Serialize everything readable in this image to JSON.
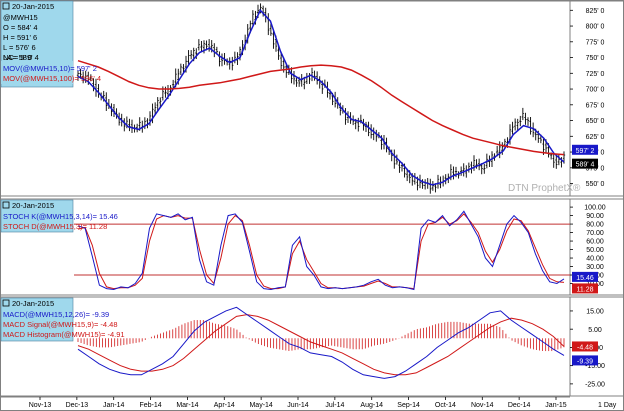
{
  "chart_data": [
    {
      "type": "ohlc",
      "panel": "price",
      "header": "20-Jan-2015",
      "info_lines": [
        "@MWH15",
        "O = 584' 4",
        "H = 591' 6",
        "L = 576' 6",
        "LA= 589' 4",
        "NC= 5' 0"
      ],
      "indicator_labels": [
        "MOV(@MWH15,10)= 597' 2",
        "MOV(@MWH15,100)= 596' 4"
      ],
      "y_ticks": [
        "825' 0",
        "800' 0",
        "775' 0",
        "750' 0",
        "725' 0",
        "700' 0",
        "675' 0",
        "650' 0",
        "625' 0",
        "600' 0",
        "575' 0",
        "550' 0"
      ],
      "ylim": [
        535,
        835
      ],
      "last_tags": [
        "597' 2",
        "589' 4"
      ],
      "watermark": "DTN ProphetX®",
      "series": [
        {
          "name": "MOV(@MWH15,10)",
          "color": "#1818c8",
          "values": [
            720,
            712,
            695,
            675,
            655,
            640,
            636,
            645,
            668,
            690,
            715,
            740,
            758,
            765,
            752,
            742,
            750,
            790,
            825,
            808,
            760,
            725,
            715,
            722,
            712,
            695,
            670,
            652,
            648,
            635,
            622,
            598,
            582,
            563,
            553,
            548,
            552,
            562,
            568,
            575,
            582,
            590,
            602,
            628,
            642,
            637,
            622,
            598,
            584
          ]
        },
        {
          "name": "MOV(@MWH15,100)",
          "color": "#d01818",
          "values": [
            745,
            740,
            735,
            728,
            720,
            712,
            706,
            702,
            700,
            700,
            701,
            703,
            706,
            708,
            710,
            713,
            716,
            720,
            724,
            728,
            730,
            732,
            735,
            737,
            738,
            737,
            735,
            730,
            722,
            713,
            702,
            690,
            680,
            670,
            660,
            650,
            642,
            635,
            628,
            622,
            618,
            614,
            610,
            607,
            604,
            601,
            599,
            597,
            596
          ]
        }
      ],
      "closes": [
        722,
        718,
        694,
        674,
        652,
        641,
        639,
        652,
        685,
        700,
        728,
        752,
        768,
        770,
        748,
        740,
        758,
        805,
        832,
        790,
        742,
        720,
        708,
        724,
        708,
        688,
        665,
        648,
        646,
        630,
        618,
        592,
        572,
        555,
        550,
        545,
        555,
        568,
        568,
        582,
        575,
        595,
        610,
        642,
        658,
        630,
        610,
        584,
        589
      ]
    },
    {
      "type": "line",
      "panel": "stochastic",
      "header": "20-Jan-2015",
      "y_ticks": [
        "100.00",
        "90.00",
        "80.00",
        "70.00",
        "60.00",
        "50.00",
        "40.00",
        "30.00",
        "20.00",
        "10.00"
      ],
      "ylim": [
        0,
        106
      ],
      "reference_lines": [
        80,
        20
      ],
      "last_tags": [
        "15.46",
        "11.28"
      ],
      "series": [
        {
          "name": "STOCH K(@MWH15,3,14)",
          "legend": "STOCH K(@MWH15,3,14)= 15.46",
          "color": "#1818c8",
          "values": [
            78,
            75,
            42,
            8,
            4,
            3,
            6,
            5,
            10,
            22,
            75,
            92,
            90,
            88,
            92,
            85,
            88,
            38,
            12,
            8,
            55,
            90,
            92,
            82,
            48,
            12,
            4,
            3,
            5,
            6,
            55,
            65,
            30,
            20,
            6,
            4,
            5,
            4,
            5,
            6,
            8,
            12,
            15,
            8,
            5,
            6,
            5,
            3,
            75,
            85,
            82,
            90,
            78,
            85,
            95,
            80,
            65,
            40,
            30,
            55,
            80,
            90,
            82,
            70,
            45,
            25,
            12,
            10,
            15.46
          ]
        },
        {
          "name": "STOCH D(@MWH15,3)",
          "legend": "STOCH D(@MWH15,3)= 11.28",
          "color": "#d01818",
          "values": [
            74,
            76,
            55,
            22,
            6,
            4,
            5,
            5,
            8,
            16,
            60,
            86,
            90,
            88,
            90,
            87,
            87,
            50,
            20,
            10,
            40,
            80,
            90,
            84,
            55,
            20,
            7,
            4,
            4,
            6,
            45,
            60,
            38,
            24,
            10,
            5,
            5,
            4,
            5,
            6,
            7,
            10,
            13,
            10,
            6,
            6,
            5,
            4,
            60,
            80,
            82,
            88,
            80,
            84,
            92,
            82,
            70,
            48,
            35,
            50,
            72,
            86,
            84,
            72,
            52,
            32,
            16,
            12,
            11.28
          ]
        }
      ]
    },
    {
      "type": "line+bar",
      "panel": "macd",
      "header": "20-Jan-2015",
      "y_ticks": [
        "15.00",
        "5.00",
        "-5.00",
        "-15.00",
        "-25.00"
      ],
      "ylim": [
        -30,
        21
      ],
      "last_tags": [
        "-4.48",
        "-9.39"
      ],
      "series": [
        {
          "name": "MACD(@MWH15,12,26)",
          "legend": "MACD(@MWH15,12,26)= -9.39",
          "color": "#1818c8",
          "values": [
            -6,
            -10,
            -14,
            -17,
            -19,
            -20,
            -20,
            -17,
            -14,
            -10,
            -3,
            4,
            9,
            12,
            15,
            17,
            13,
            9,
            5,
            1,
            -3,
            -5,
            -8,
            -9,
            -10,
            -13,
            -17,
            -20,
            -21,
            -22,
            -21,
            -18,
            -14,
            -10,
            -5,
            -1,
            3,
            6,
            10,
            14,
            15,
            10,
            6,
            2,
            -2,
            -6,
            -9.39
          ]
        },
        {
          "name": "MACD Signal(@MWH15,9)",
          "legend": "MACD Signal(@MWH15,9)= -4.48",
          "color": "#d01818",
          "values": [
            -4,
            -6,
            -9,
            -12,
            -15,
            -17,
            -18,
            -18,
            -17,
            -15,
            -11,
            -6,
            -1,
            4,
            8,
            12,
            13,
            12,
            10,
            7,
            4,
            1,
            -2,
            -4,
            -6,
            -8,
            -11,
            -14,
            -17,
            -19,
            -20,
            -20,
            -19,
            -16,
            -13,
            -10,
            -6,
            -2,
            2,
            6,
            9,
            11,
            10,
            8,
            5,
            1,
            -4.48
          ]
        },
        {
          "name": "MACD Histogram(@MWH15)",
          "legend": "MACD Histogram(@MWH15)= -4.91",
          "color": "#d01818",
          "values": [
            -2,
            -4,
            -5,
            -5,
            -4,
            -3,
            -2,
            1,
            3,
            5,
            8,
            10,
            10,
            8,
            7,
            5,
            0,
            -3,
            -5,
            -6,
            -7,
            -6,
            -6,
            -5,
            -4,
            -5,
            -6,
            -6,
            -4,
            -3,
            -1,
            2,
            5,
            6,
            8,
            9,
            9,
            8,
            8,
            8,
            6,
            -1,
            -4,
            -6,
            -7,
            -7,
            -4.91
          ]
        }
      ]
    }
  ],
  "x_ticks": [
    "Nov-13",
    "Dec-13",
    "Jan-14",
    "Feb-14",
    "Mar-14",
    "Apr-14",
    "May-14",
    "Jun-14",
    "Jul-14",
    "Aug-14",
    "Sep-14",
    "Oct-14",
    "Nov-14",
    "Dec-14",
    "Jan-15"
  ],
  "interval": "1 Day",
  "colors": {
    "background": "#ffffff",
    "info_box": "#9fd8ec",
    "k_line": "#1818c8",
    "d_line": "#d01818",
    "price_bars": "#000000",
    "ref_line": "#c03030",
    "tag_blue": "#1818c8",
    "tag_red": "#d01818",
    "tag_black": "#000000"
  }
}
